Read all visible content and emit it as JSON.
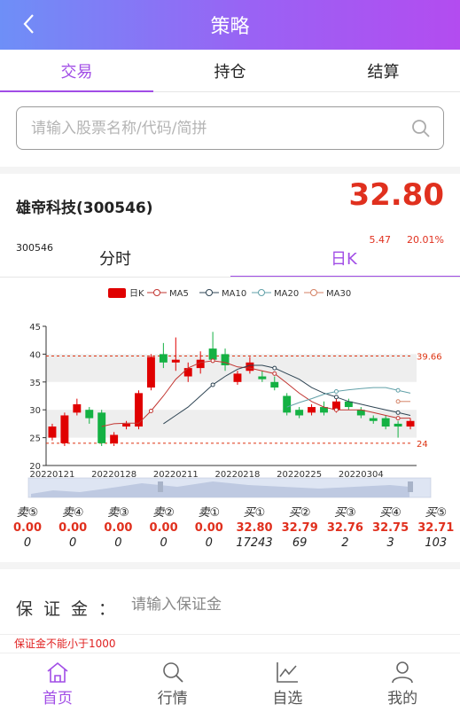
{
  "header": {
    "title": "策略",
    "back_icon": "chevron-left-icon"
  },
  "tabs": [
    {
      "label": "交易",
      "active": true
    },
    {
      "label": "持仓",
      "active": false
    },
    {
      "label": "结算",
      "active": false
    }
  ],
  "search": {
    "placeholder": "请输入股票名称/代码/简拼",
    "value": ""
  },
  "quote": {
    "name": "雄帝科技(300546)",
    "code": "300546",
    "price": "32.80",
    "change": "5.47",
    "change_pct": "20.01%",
    "up_color": "#e0301e"
  },
  "chart_tabs": [
    {
      "label": "分时",
      "active": false
    },
    {
      "label": "日K",
      "active": true
    }
  ],
  "chart_data": {
    "type": "candlestick",
    "legend": [
      "日K",
      "MA5",
      "MA10",
      "MA20",
      "MA30"
    ],
    "legend_colors": [
      "#e00000",
      "#c23531",
      "#2f4554",
      "#61a0a8",
      "#d48265"
    ],
    "ylim": [
      20,
      45
    ],
    "y_ticks": [
      20,
      25,
      30,
      35,
      40,
      45
    ],
    "x_labels": [
      "20220121",
      "20220128",
      "20220211",
      "20220218",
      "20220225",
      "20220304"
    ],
    "markline_high": 39.66,
    "markline_low": 24,
    "up_color": "#e00000",
    "down_color": "#14b143",
    "candles": [
      {
        "o": 25.0,
        "c": 27.0,
        "l": 24.5,
        "h": 27.5
      },
      {
        "o": 24.0,
        "c": 29.0,
        "l": 23.5,
        "h": 29.5
      },
      {
        "o": 29.5,
        "c": 31.0,
        "l": 29.0,
        "h": 32.0
      },
      {
        "o": 30.0,
        "c": 28.5,
        "l": 27.5,
        "h": 30.5
      },
      {
        "o": 29.5,
        "c": 24.0,
        "l": 23.5,
        "h": 30.0
      },
      {
        "o": 24.0,
        "c": 25.5,
        "l": 23.5,
        "h": 26.0
      },
      {
        "o": 27.0,
        "c": 27.5,
        "l": 26.5,
        "h": 28.0
      },
      {
        "o": 27.0,
        "c": 33.0,
        "l": 26.5,
        "h": 33.5
      },
      {
        "o": 34.0,
        "c": 39.5,
        "l": 33.5,
        "h": 40.0
      },
      {
        "o": 40.0,
        "c": 38.5,
        "l": 37.5,
        "h": 42.0
      },
      {
        "o": 38.5,
        "c": 39.0,
        "l": 37.0,
        "h": 43.0
      },
      {
        "o": 36.0,
        "c": 37.5,
        "l": 35.0,
        "h": 38.5
      },
      {
        "o": 37.5,
        "c": 39.0,
        "l": 36.5,
        "h": 40.5
      },
      {
        "o": 41.0,
        "c": 39.0,
        "l": 38.5,
        "h": 44.0
      },
      {
        "o": 40.0,
        "c": 38.0,
        "l": 37.0,
        "h": 41.0
      },
      {
        "o": 35.0,
        "c": 36.5,
        "l": 34.5,
        "h": 37.0
      },
      {
        "o": 37.0,
        "c": 38.5,
        "l": 36.5,
        "h": 39.5
      },
      {
        "o": 36.0,
        "c": 35.5,
        "l": 35.0,
        "h": 37.0
      },
      {
        "o": 35.0,
        "c": 34.0,
        "l": 33.5,
        "h": 36.0
      },
      {
        "o": 32.5,
        "c": 29.5,
        "l": 29.0,
        "h": 33.0
      },
      {
        "o": 30.0,
        "c": 29.0,
        "l": 28.5,
        "h": 30.5
      },
      {
        "o": 29.5,
        "c": 30.5,
        "l": 29.0,
        "h": 31.0
      },
      {
        "o": 30.5,
        "c": 29.5,
        "l": 29.0,
        "h": 31.5
      },
      {
        "o": 30.0,
        "c": 31.5,
        "l": 29.5,
        "h": 32.0
      },
      {
        "o": 31.5,
        "c": 30.5,
        "l": 30.0,
        "h": 32.0
      },
      {
        "o": 30.0,
        "c": 29.0,
        "l": 28.5,
        "h": 30.5
      },
      {
        "o": 28.5,
        "c": 28.0,
        "l": 27.5,
        "h": 29.0
      },
      {
        "o": 28.5,
        "c": 27.0,
        "l": 26.5,
        "h": 29.0
      },
      {
        "o": 27.5,
        "c": 27.0,
        "l": 25.0,
        "h": 28.0
      },
      {
        "o": 27.0,
        "c": 28.0,
        "l": 26.5,
        "h": 28.5
      }
    ],
    "ma_series": [
      {
        "name": "MA5",
        "values": [
          null,
          null,
          null,
          null,
          27.0,
          27.5,
          27.6,
          27.6,
          29.8,
          32.5,
          35.5,
          37.5,
          38.5,
          38.8,
          38.5,
          37.7,
          37.5,
          37.0,
          36.5,
          34.8,
          33.0,
          31.5,
          30.5,
          30.0,
          30.0,
          30.0,
          29.5,
          29.0,
          28.5,
          28.5
        ]
      },
      {
        "name": "MA10",
        "values": [
          null,
          null,
          null,
          null,
          null,
          null,
          null,
          null,
          null,
          27.5,
          29.0,
          30.5,
          32.5,
          34.5,
          36.0,
          37.3,
          38.0,
          38.0,
          37.5,
          36.5,
          35.5,
          34.0,
          33.0,
          32.3,
          31.5,
          31.0,
          30.5,
          30.0,
          29.5,
          29.0
        ]
      },
      {
        "name": "MA20",
        "values": [
          null,
          null,
          null,
          null,
          null,
          null,
          null,
          null,
          null,
          null,
          null,
          null,
          null,
          null,
          null,
          null,
          null,
          null,
          null,
          30.5,
          31.3,
          32.0,
          32.8,
          33.3,
          33.6,
          33.8,
          34.0,
          34.0,
          33.5,
          33.0
        ]
      },
      {
        "name": "MA30",
        "values": [
          null,
          null,
          null,
          null,
          null,
          null,
          null,
          null,
          null,
          null,
          null,
          null,
          null,
          null,
          null,
          null,
          null,
          null,
          null,
          null,
          null,
          null,
          null,
          null,
          null,
          null,
          null,
          null,
          31.5,
          31.5
        ]
      }
    ]
  },
  "order_book": [
    {
      "label": "卖⑤",
      "price": "0.00",
      "volume": "0"
    },
    {
      "label": "卖④",
      "price": "0.00",
      "volume": "0"
    },
    {
      "label": "卖③",
      "price": "0.00",
      "volume": "0"
    },
    {
      "label": "卖②",
      "price": "0.00",
      "volume": "0"
    },
    {
      "label": "卖①",
      "price": "0.00",
      "volume": "0"
    },
    {
      "label": "买①",
      "price": "32.80",
      "volume": "17243"
    },
    {
      "label": "买②",
      "price": "32.79",
      "volume": "69"
    },
    {
      "label": "买③",
      "price": "32.76",
      "volume": "2"
    },
    {
      "label": "买④",
      "price": "32.75",
      "volume": "3"
    },
    {
      "label": "买⑤",
      "price": "32.71",
      "volume": "103"
    }
  ],
  "margin": {
    "label": "保证金：",
    "placeholder": "请输入保证金",
    "value": "",
    "warning": "保证金不能小于1000"
  },
  "bottom_nav": [
    {
      "label": "首页",
      "icon": "home-icon",
      "active": true
    },
    {
      "label": "行情",
      "icon": "search-icon",
      "active": false
    },
    {
      "label": "自选",
      "icon": "chart-icon",
      "active": false
    },
    {
      "label": "我的",
      "icon": "user-icon",
      "active": false
    }
  ],
  "theme": {
    "accent": "#a14de6",
    "up": "#e0301e",
    "down": "#14b143"
  }
}
